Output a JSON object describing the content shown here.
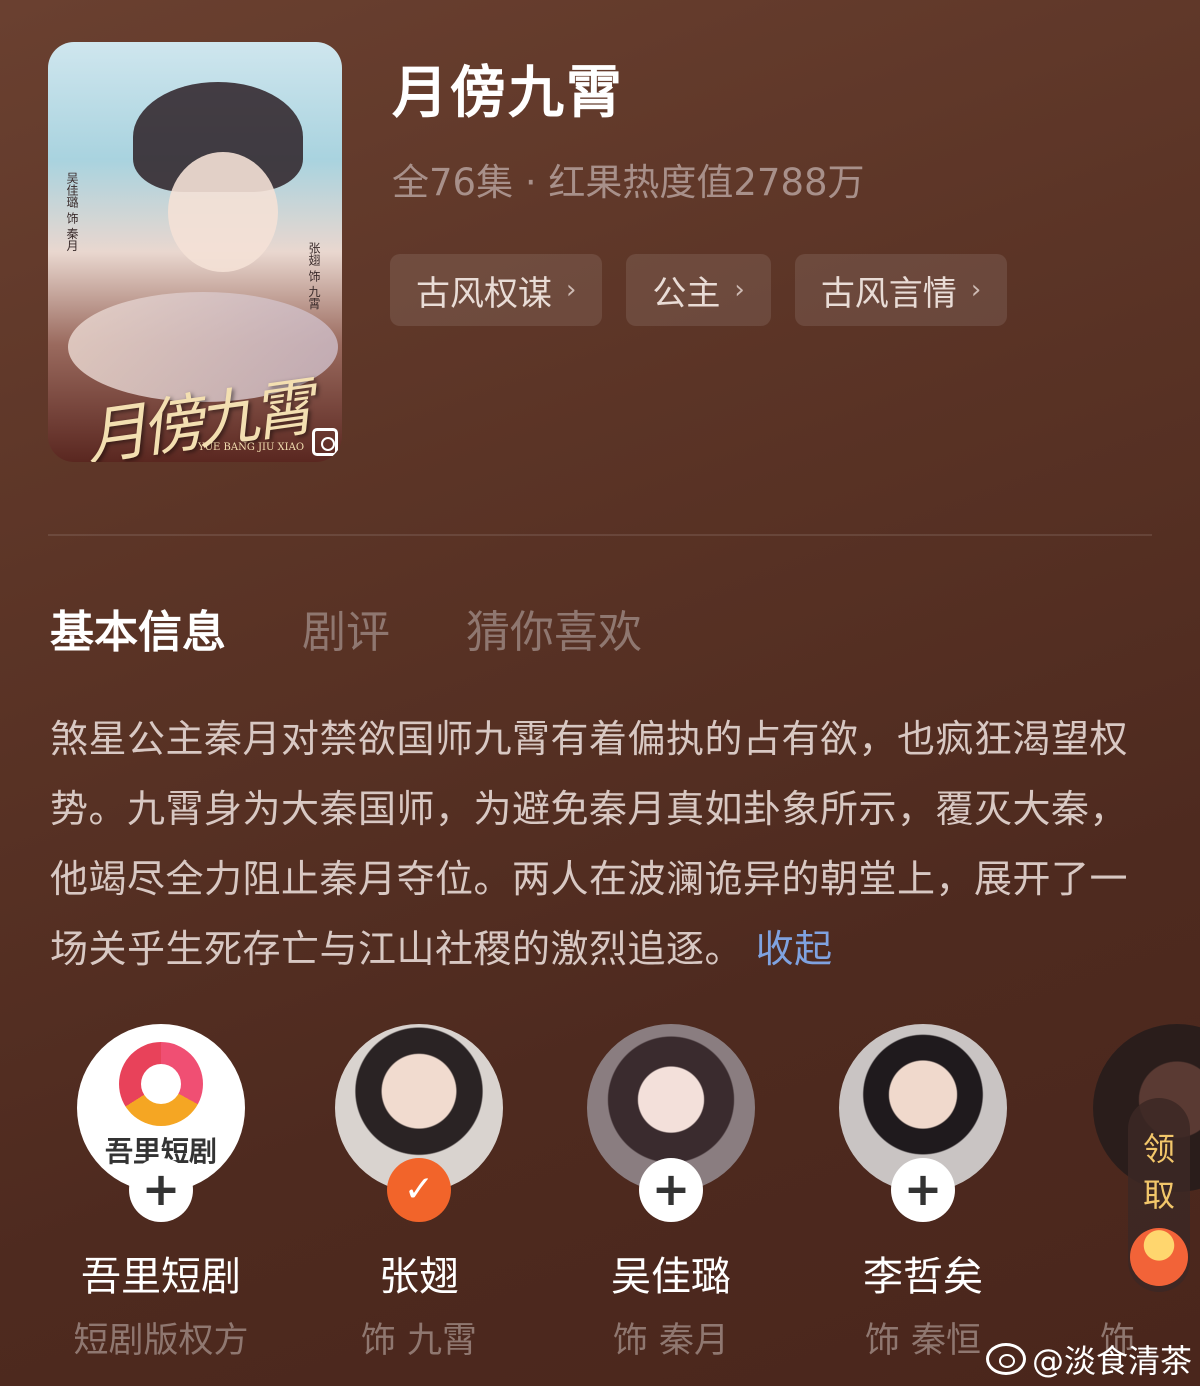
{
  "drama": {
    "title": "月傍九霄",
    "meta": "全76集 · 红果热度值2788万",
    "poster": {
      "logo_text": "月傍九霄",
      "en_text": "YUE BANG JIU XIAO",
      "cast_left": "吴佳璐 饰 秦月",
      "cast_right": "张翅 饰 九霄"
    },
    "tags": [
      {
        "label": "古风权谋",
        "chevron": "›"
      },
      {
        "label": "公主",
        "chevron": "›"
      },
      {
        "label": "古风言情",
        "chevron": "›"
      }
    ]
  },
  "tabs": [
    {
      "label": "基本信息",
      "active": true
    },
    {
      "label": "剧评",
      "active": false
    },
    {
      "label": "猜你喜欢",
      "active": false
    }
  ],
  "synopsis": {
    "text": "煞星公主秦月对禁欲国师九霄有着偏执的占有欲，也疯狂渴望权势。九霄身为大秦国师，为避免秦月真如卦象所示，覆灭大秦，他竭尽全力阻止秦月夺位。两人在波澜诡异的朝堂上，展开了一场关乎生死存亡与江山社稷的激烈追逐。",
    "collapse_label": "收起"
  },
  "cast": [
    {
      "name": "吾里短剧",
      "role": "短剧版权方",
      "badge": "+",
      "avatar": "brand-logo",
      "brand_text": "吾里短剧"
    },
    {
      "name": "张翅",
      "role": "饰 九霄",
      "badge": "✓",
      "avatar": "person-photo"
    },
    {
      "name": "吴佳璐",
      "role": "饰 秦月",
      "badge": "+",
      "avatar": "person-photo"
    },
    {
      "name": "李哲矣",
      "role": "饰 秦恒",
      "badge": "+",
      "avatar": "person-photo"
    },
    {
      "name": "",
      "role": "饰",
      "badge": "",
      "avatar": "person-photo"
    }
  ],
  "reward": {
    "label": "领取",
    "icon": "red-envelope-icon"
  },
  "watermark": {
    "text": "@淡食清茶",
    "icon": "weibo-icon"
  },
  "colors": {
    "accent_orange": "#f2642a",
    "link_blue": "#7fa2e0",
    "bg": "#5b3426"
  }
}
